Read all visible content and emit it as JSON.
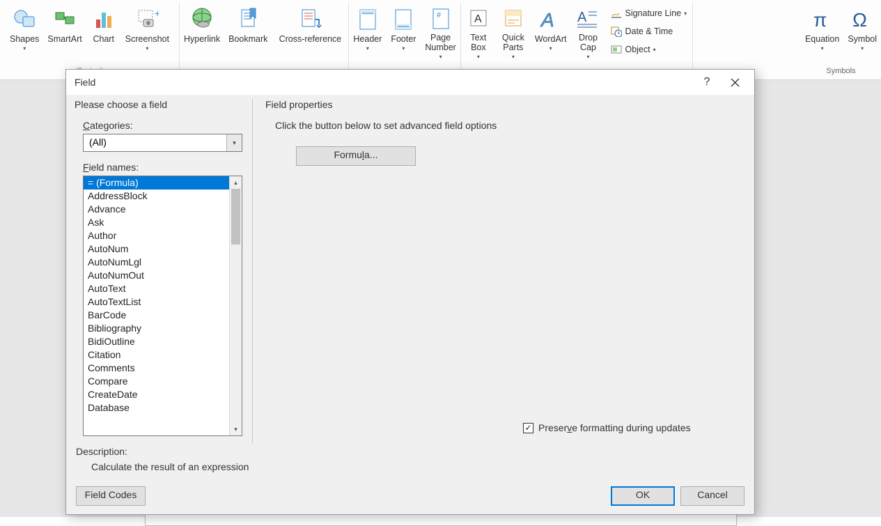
{
  "ribbon": {
    "illustrations_label": "Illustrati",
    "symbols_label": "Symbols",
    "shapes": "Shapes",
    "smartart": "SmartArt",
    "chart": "Chart",
    "screenshot": "Screenshot",
    "hyperlink": "Hyperlink",
    "bookmark": "Bookmark",
    "crossref": "Cross-reference",
    "header": "Header",
    "footer": "Footer",
    "pagenum": "Page\nNumber",
    "textbox": "Text\nBox",
    "quickparts": "Quick\nParts",
    "wordart": "WordArt",
    "dropcap": "Drop\nCap",
    "sigline": "Signature Line",
    "datetime": "Date & Time",
    "object": "Object",
    "equation": "Equation",
    "symbol": "Symbol"
  },
  "dialog": {
    "title": "Field",
    "choose": "Please choose a field",
    "categories_label": "Categories:",
    "categories_prefix": "C",
    "category_value": "(All)",
    "fieldnames_label": "ield names:",
    "fieldnames_prefix": "F",
    "field_list": [
      "= (Formula)",
      "AddressBlock",
      "Advance",
      "Ask",
      "Author",
      "AutoNum",
      "AutoNumLgl",
      "AutoNumOut",
      "AutoText",
      "AutoTextList",
      "BarCode",
      "Bibliography",
      "BidiOutline",
      "Citation",
      "Comments",
      "Compare",
      "CreateDate",
      "Database"
    ],
    "selected_index": 0,
    "properties_head": "Field properties",
    "instruction": "Click the button below to set advanced field options",
    "formula_btn_pre": "Formu",
    "formula_btn_und": "l",
    "formula_btn_post": "a...",
    "preserve_pre": "Preser",
    "preserve_und": "v",
    "preserve_post": "e formatting during updates",
    "desc_label": "Description:",
    "desc_text": "Calculate the result of an expression",
    "field_codes": "Field Codes",
    "ok": "OK",
    "cancel": "Cancel"
  }
}
